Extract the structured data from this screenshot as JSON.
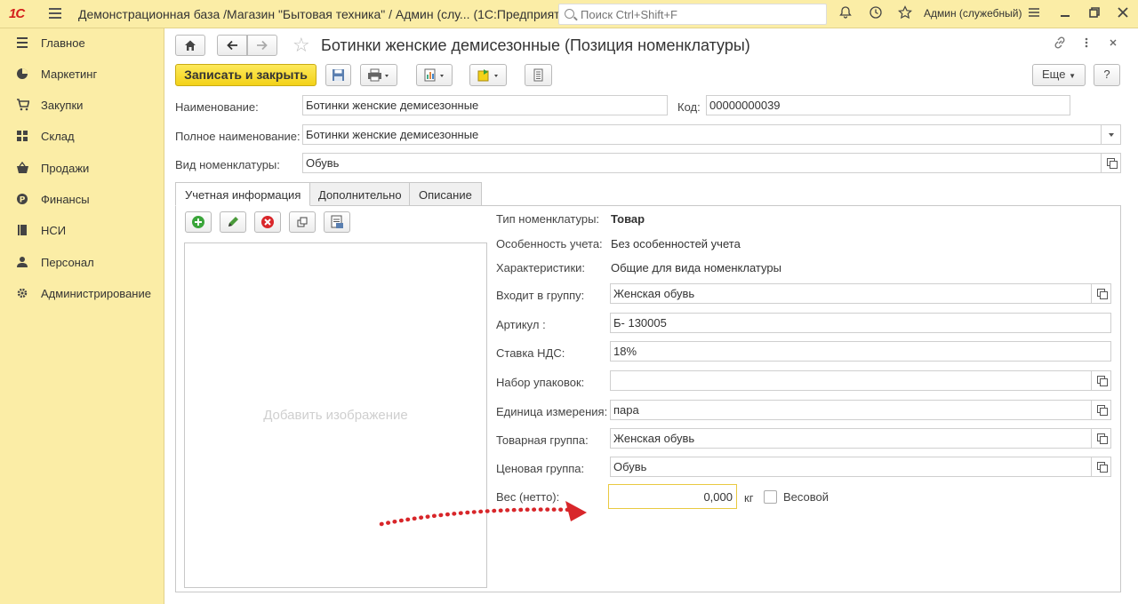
{
  "topbar": {
    "logo": "1С",
    "title": "Демонстрационная база /Магазин \"Бытовая техника\" / Админ (слу...  (1С:Предприятие)",
    "search_placeholder": "Поиск Ctrl+Shift+F",
    "user": "Админ (служебный)"
  },
  "sidebar": {
    "items": [
      {
        "label": "Главное",
        "icon": "menu-lines-icon"
      },
      {
        "label": "Маркетинг",
        "icon": "pie-chart-icon"
      },
      {
        "label": "Закупки",
        "icon": "cart-icon"
      },
      {
        "label": "Склад",
        "icon": "grid-icon"
      },
      {
        "label": "Продажи",
        "icon": "basket-icon"
      },
      {
        "label": "Финансы",
        "icon": "coin-icon"
      },
      {
        "label": "НСИ",
        "icon": "book-icon"
      },
      {
        "label": "Персонал",
        "icon": "person-icon"
      },
      {
        "label": "Администрирование",
        "icon": "gear-icon"
      }
    ]
  },
  "header": {
    "title": "Ботинки женские демисезонные (Позиция номенклатуры)"
  },
  "toolbar": {
    "save_close_label": "Записать и закрыть",
    "more_label": "Еще",
    "help_label": "?"
  },
  "form": {
    "name_label": "Наименование:",
    "name_value": "Ботинки женские демисезонные",
    "code_label": "Код:",
    "code_value": "00000000039",
    "full_name_label": "Полное наименование:",
    "full_name_value": "Ботинки женские демисезонные",
    "kind_label": "Вид номенклатуры:",
    "kind_value": "Обувь"
  },
  "tabs": [
    {
      "label": "Учетная информация",
      "active": true
    },
    {
      "label": "Дополнительно",
      "active": false
    },
    {
      "label": "Описание",
      "active": false
    }
  ],
  "image_placeholder": "Добавить изображение",
  "details": {
    "type_label": "Тип номенклатуры:",
    "type_value": "Товар",
    "feature_label": "Особенность учета:",
    "feature_value": "Без особенностей учета",
    "chars_label": "Характеристики:",
    "chars_value": "Общие для вида номенклатуры",
    "group_label": "Входит в группу:",
    "group_value": "Женская обувь",
    "article_label": "Артикул :",
    "article_value": "Б- 130005",
    "vat_label": "Ставка НДС:",
    "vat_value": "18%",
    "packs_label": "Набор упаковок:",
    "packs_value": "",
    "unit_label": "Единица измерения:",
    "unit_value": "пара",
    "goods_group_label": "Товарная группа:",
    "goods_group_value": "Женская обувь",
    "price_group_label": "Ценовая группа:",
    "price_group_value": "Обувь",
    "weight_label": "Вес (нетто):",
    "weight_value": "0,000",
    "weight_unit": "кг",
    "weighted_label": "Весовой"
  },
  "colors": {
    "panel_bg": "#fbeda6",
    "accent_button": "#f3d218",
    "annotation_arrow": "#d8262a"
  }
}
